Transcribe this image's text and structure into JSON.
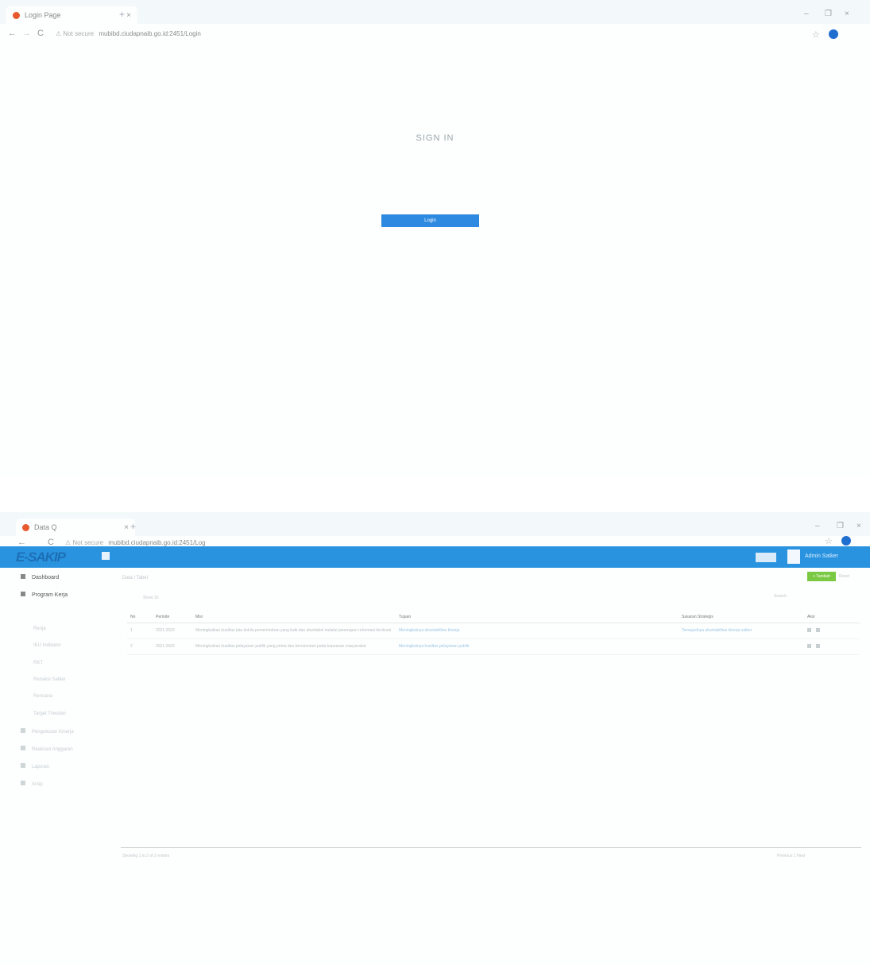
{
  "login": {
    "tab": {
      "title": "Login Page",
      "close": "×",
      "new": "+"
    },
    "window_controls": [
      "–",
      "❐",
      "×"
    ],
    "address": {
      "back": "←",
      "forward": "→",
      "reload": "C",
      "warning": "⚠ Not secure",
      "url": "mubibd.ciudapnaib.go.id:2451/Login"
    },
    "signin_title": "SIGN IN",
    "login_button": "Login"
  },
  "dashboard": {
    "tab": {
      "title": "Data Q",
      "close": "×",
      "new": "+"
    },
    "window_controls": [
      "–",
      "❐",
      "×"
    ],
    "address": {
      "back": "←",
      "reload": "C",
      "warning": "⚠ Not secure",
      "url": "mubibd.ciudapnaib.go.id:2451/Log"
    },
    "logo": "E-SAKIP",
    "user_name": "Admin Satker",
    "sidebar": {
      "dashboard": "Dashboard",
      "program": "Program Kerja",
      "sub_items": [
        "Renja",
        "IKU Indikator",
        "RKT",
        "Renaksi Satker",
        "Rencana",
        "Target Triwulan"
      ],
      "group_items": [
        "Pengukuran Kinerja",
        "Realisasi Anggaran",
        "Laporan",
        "Arsip"
      ]
    },
    "content": {
      "breadcrumb": "Data / Tabel",
      "add_label": "+ Tambah",
      "reset_label": "Reset",
      "show": "Show 10",
      "search": "Search:",
      "columns": [
        "No",
        "Periode",
        "Misi",
        "Tujuan",
        "",
        "Sasaran Strategis",
        "Aksi"
      ],
      "rows": [
        {
          "no": "1",
          "periode": "2021-2022",
          "misi": "Meningkatkan kualitas tata kelola pemerintahan yang baik dan akuntabel melalui penerapan reformasi birokrasi",
          "tujuan": "Meningkatnya akuntabilitas kinerja",
          "blank": "",
          "sasaran": "Terwujudnya akuntabilitas kinerja satker"
        },
        {
          "no": "2",
          "periode": "2021-2022",
          "misi": "Meningkatkan kualitas pelayanan publik yang prima dan berorientasi pada kepuasan masyarakat",
          "tujuan": "Meningkatnya kualitas pelayanan publik",
          "blank": "",
          "sasaran": ""
        }
      ],
      "footer": "Showing 1 to 2 of 2 entries",
      "pager": "Previous   1   Next"
    }
  }
}
